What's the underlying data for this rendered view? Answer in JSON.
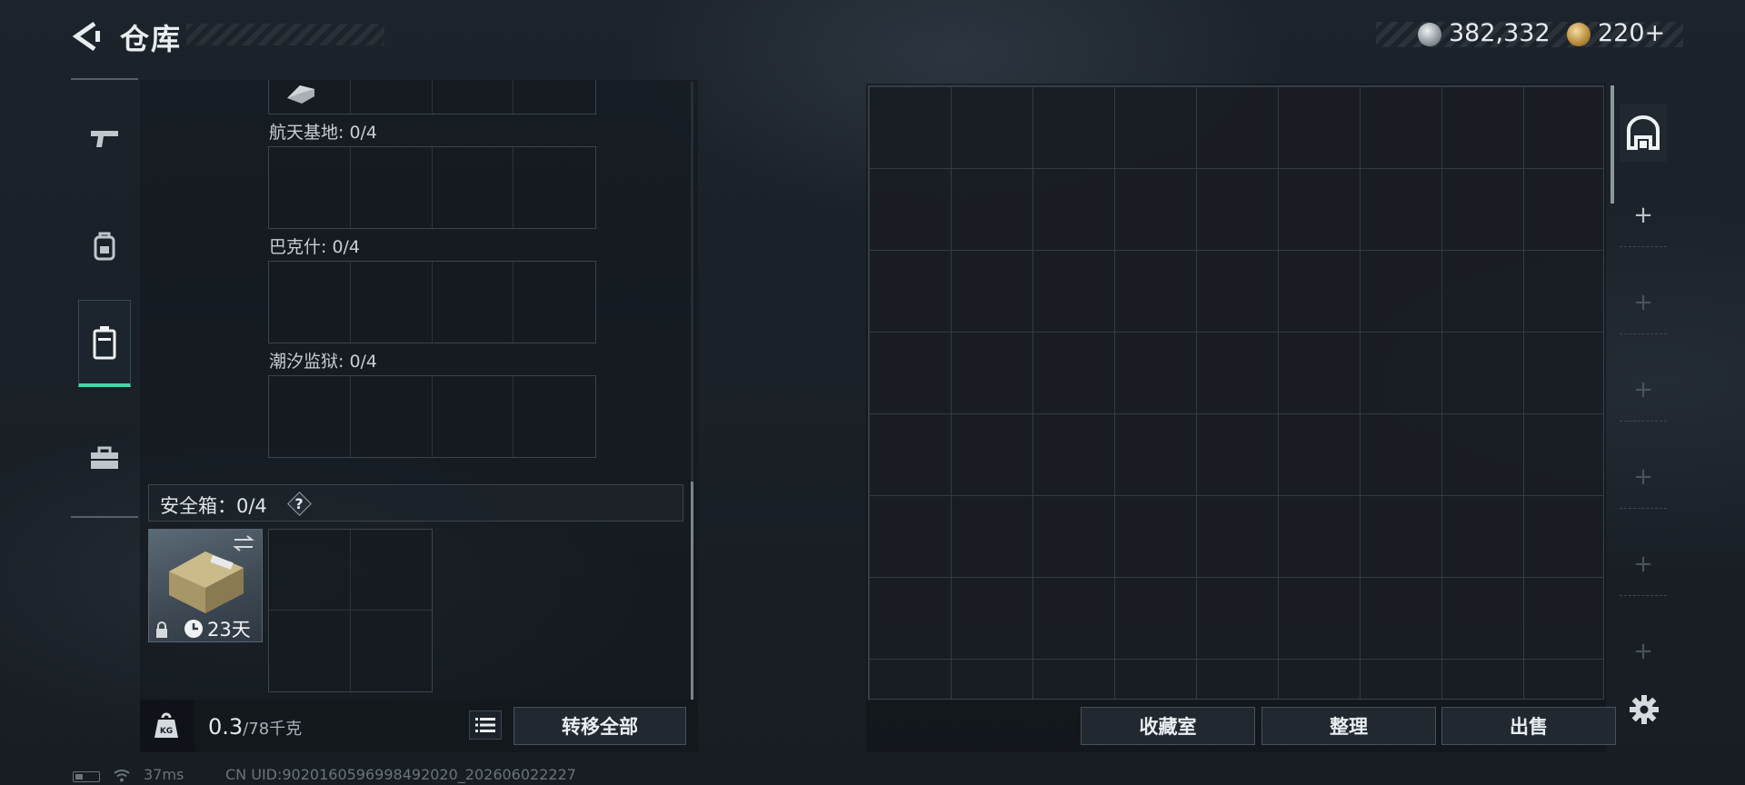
{
  "header": {
    "title": "仓库"
  },
  "currency": {
    "silver": "382,332",
    "gold": "220+"
  },
  "sidenav": {
    "items": [
      {
        "name": "weapons",
        "icon": "pistol-icon",
        "active": false
      },
      {
        "name": "gear",
        "icon": "backpack-icon",
        "active": false
      },
      {
        "name": "containers",
        "icon": "case-icon",
        "active": true
      },
      {
        "name": "tools",
        "icon": "toolbox-icon",
        "active": false
      }
    ]
  },
  "left_panel": {
    "sections": [
      {
        "label": "航天基地: 0/4"
      },
      {
        "label": "巴克什: 0/4"
      },
      {
        "label": "潮汐监狱: 0/4"
      }
    ],
    "safe_box": {
      "label": "安全箱：0/4",
      "help": "?",
      "days_left": "23天"
    },
    "weight": {
      "current": "0.3",
      "max": "/78千克"
    },
    "transfer_all": "转移全部"
  },
  "stash": {
    "actions": {
      "collection": "收藏室",
      "organize": "整理",
      "sell": "出售"
    },
    "side_tabs": [
      "+",
      "+",
      "+",
      "+",
      "+",
      "+"
    ]
  },
  "status_bar": {
    "ping": "37ms",
    "uid": "CN UID:9020160596998492020_202606022227"
  },
  "colors": {
    "accent": "#4fd0a6",
    "background": "#1a2027",
    "panel_border": "#3b434c"
  }
}
